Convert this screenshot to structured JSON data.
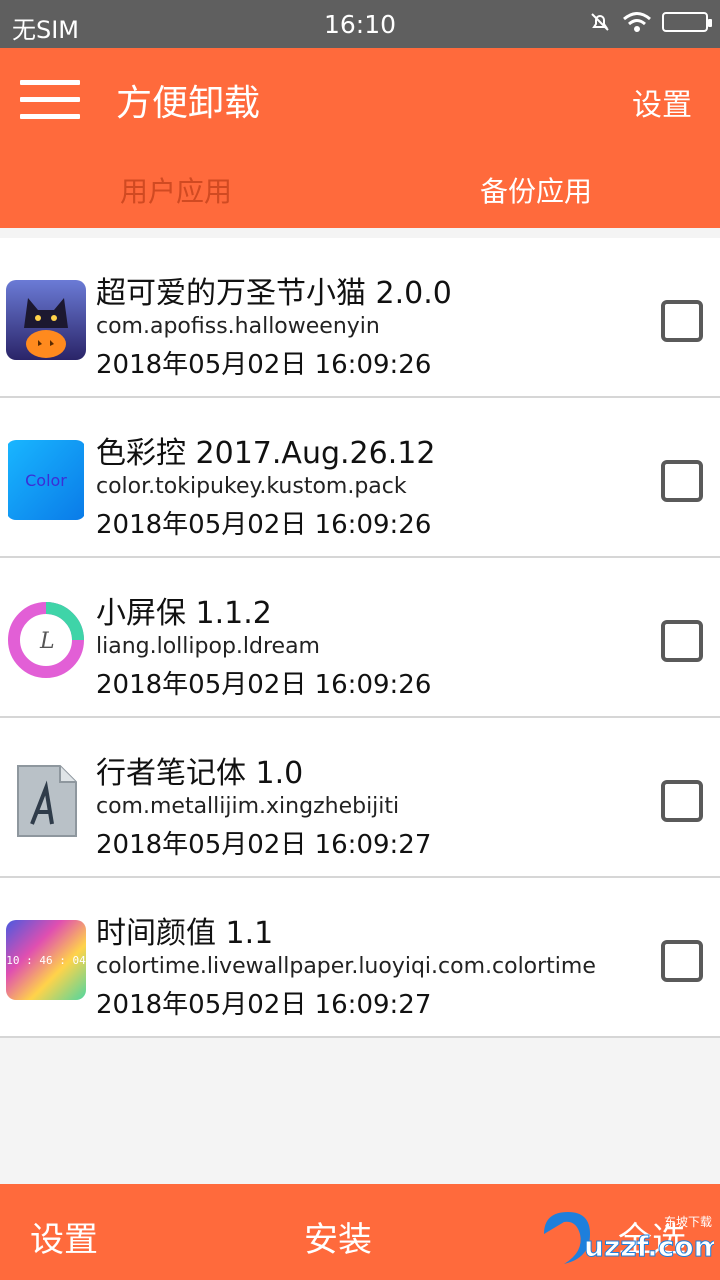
{
  "status": {
    "carrier": "无SIM",
    "time": "16:10"
  },
  "appbar": {
    "title": "方便卸载",
    "settings_label": "设置"
  },
  "tabs": [
    {
      "label": "用户应用"
    },
    {
      "label": "备份应用"
    }
  ],
  "apps": [
    {
      "name": "超可爱的万圣节小猫 2.0.0",
      "package": "com.apofiss.halloweenyin",
      "date": "2018年05月02日 16:09:26",
      "checked": false
    },
    {
      "name": "色彩控 2017.Aug.26.12",
      "package": "color.tokipukey.kustom.pack",
      "date": "2018年05月02日 16:09:26",
      "checked": false
    },
    {
      "name": "小屏保 1.1.2",
      "package": "liang.lollipop.ldream",
      "date": "2018年05月02日 16:09:26",
      "checked": false
    },
    {
      "name": "行者笔记体 1.0",
      "package": "com.metallijim.xingzhebijiti",
      "date": "2018年05月02日 16:09:27",
      "checked": false
    },
    {
      "name": "时间颜值 1.1",
      "package": "colortime.livewallpaper.luoyiqi.com.colortime",
      "date": "2018年05月02日 16:09:27",
      "checked": false
    }
  ],
  "icons": {
    "color_app_label": "Color",
    "time_app_label": "10 : 46 : 04",
    "dream_app_label": "L"
  },
  "bottombar": {
    "settings_label": "设置",
    "install_label": "安装",
    "selectall_label": "全选"
  },
  "watermark": {
    "text": "uzzf.com",
    "subtext": "东坡下载"
  },
  "colors": {
    "accent": "#ff6a3c",
    "tab_active": "#d04a22",
    "statusbar": "#5f5f5f"
  }
}
